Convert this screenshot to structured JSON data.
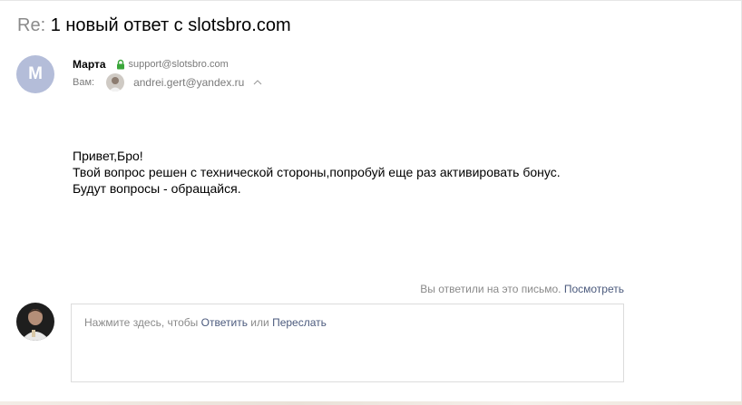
{
  "subject": {
    "prefix": "Re:",
    "title": "1 новый ответ с slotsbro.com"
  },
  "sender": {
    "avatar_letter": "M",
    "name": "Марта",
    "email": "support@slotsbro.com"
  },
  "recipient": {
    "label": "Вам:",
    "email": "andrei.gert@yandex.ru"
  },
  "body": {
    "lines": [
      "Привет,Бро!",
      "Твой вопрос решен с технической стороны,попробуй еще раз активировать бонус.",
      "Будут вопросы - обращайся."
    ]
  },
  "reply_status": {
    "text": "Вы ответили на это письмо.",
    "link": "Посмотреть"
  },
  "reply_box": {
    "hint_prefix": "Нажмите здесь, чтобы",
    "reply_link": "Ответить",
    "or_text": "или",
    "forward_link": "Переслать"
  },
  "colors": {
    "avatar_bg": "#b4bdd9",
    "lock_green": "#3aa63a",
    "link": "#4b5a7d",
    "muted": "#8a8a8a"
  },
  "icons": {
    "lock": "lock-icon",
    "expand": "chevron-up-icon"
  }
}
